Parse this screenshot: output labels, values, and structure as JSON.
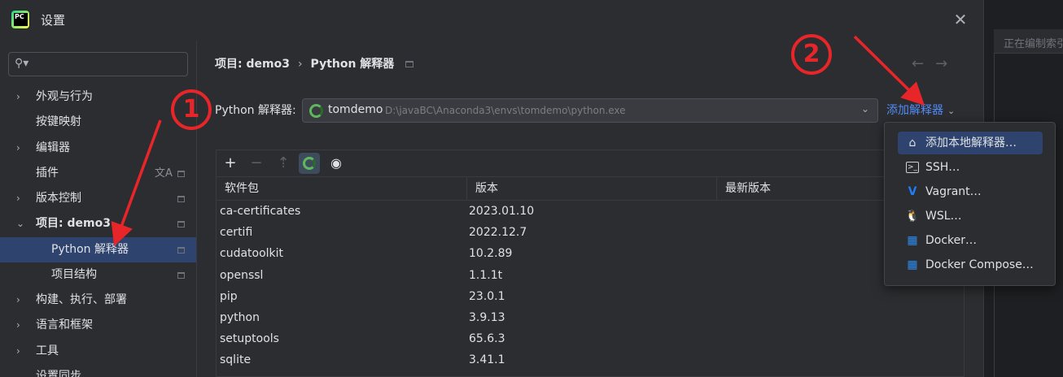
{
  "window": {
    "title": "设置"
  },
  "background_ide": {
    "indexing_text": "正在编制索引"
  },
  "sidebar": {
    "items": [
      {
        "label": "外观与行为",
        "expandable": true
      },
      {
        "label": "按键映射",
        "expandable": false
      },
      {
        "label": "编辑器",
        "expandable": true
      },
      {
        "label": "插件",
        "expandable": false
      },
      {
        "label": "版本控制",
        "expandable": true
      },
      {
        "label": "项目: demo3",
        "expandable": true,
        "expanded": true
      },
      {
        "label": "Python 解释器",
        "child": true,
        "selected": true
      },
      {
        "label": "项目结构",
        "child": true
      },
      {
        "label": "构建、执行、部署",
        "expandable": true
      },
      {
        "label": "语言和框架",
        "expandable": true
      },
      {
        "label": "工具",
        "expandable": true
      },
      {
        "label": "设置同步",
        "expandable": false
      }
    ]
  },
  "breadcrumb": {
    "project": "项目: demo3",
    "separator": "›",
    "page": "Python 解释器"
  },
  "interpreter": {
    "label": "Python 解释器:",
    "name": "tomdemo",
    "path": "D:\\javaBC\\Anaconda3\\envs\\tomdemo\\python.exe",
    "add_link": "添加解释器"
  },
  "packages": {
    "columns": [
      "软件包",
      "版本",
      "最新版本"
    ],
    "rows": [
      {
        "name": "ca-certificates",
        "version": "2023.01.10"
      },
      {
        "name": "certifi",
        "version": "2022.12.7"
      },
      {
        "name": "cudatoolkit",
        "version": "10.2.89"
      },
      {
        "name": "openssl",
        "version": "1.1.1t"
      },
      {
        "name": "pip",
        "version": "23.0.1"
      },
      {
        "name": "python",
        "version": "3.9.13"
      },
      {
        "name": "setuptools",
        "version": "65.6.3"
      },
      {
        "name": "sqlite",
        "version": "3.41.1"
      }
    ]
  },
  "add_menu": {
    "items": [
      {
        "label": "添加本地解释器…",
        "icon": "home-icon"
      },
      {
        "label": "SSH…",
        "icon": "terminal-icon"
      },
      {
        "label": "Vagrant…",
        "icon": "vagrant-icon"
      },
      {
        "label": "WSL…",
        "icon": "linux-icon"
      },
      {
        "label": "Docker…",
        "icon": "docker-icon"
      },
      {
        "label": "Docker Compose…",
        "icon": "docker-icon"
      }
    ]
  },
  "annotations": {
    "marker1": "1",
    "marker2": "2",
    "color": "#e8262a"
  }
}
